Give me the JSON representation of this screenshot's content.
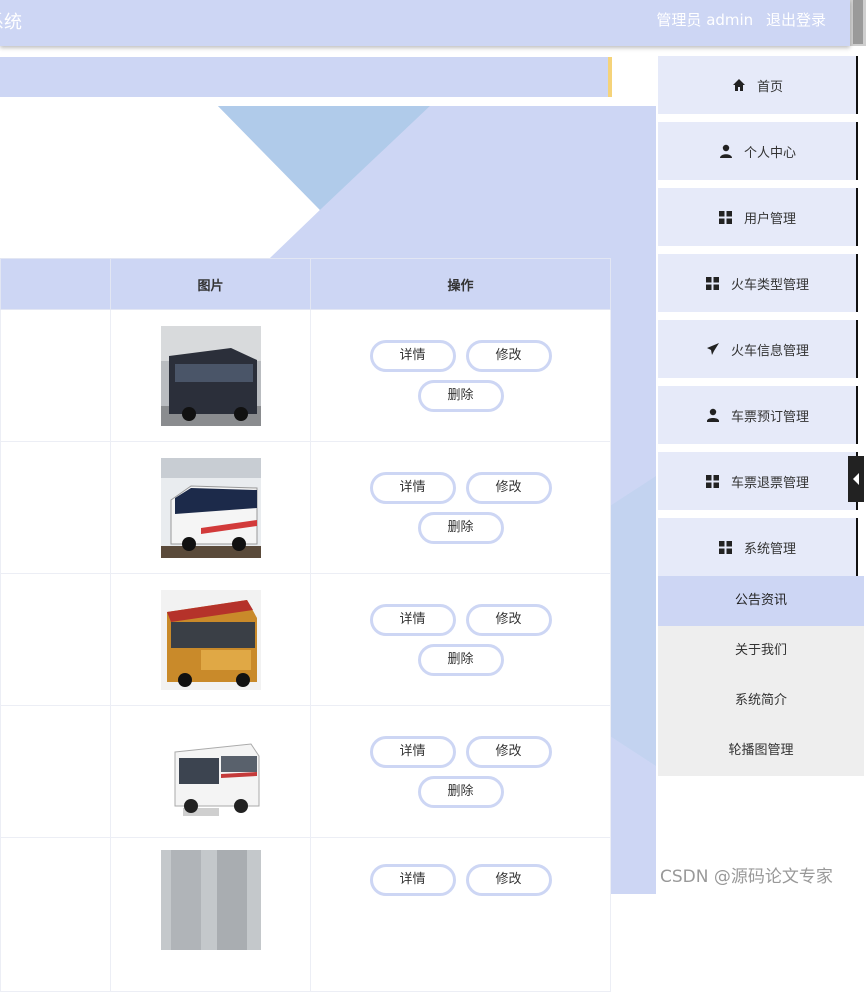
{
  "header": {
    "title_fragment": "系统",
    "user_label": "管理员 admin",
    "logout_label": "退出登录"
  },
  "table": {
    "columns": [
      "图片",
      "操作"
    ],
    "rows": [
      {
        "image": "coach-bus-dark-blue-photo",
        "actions": [
          "详情",
          "修改",
          "删除"
        ]
      },
      {
        "image": "coach-bus-white-blue-photo",
        "actions": [
          "详情",
          "修改",
          "删除"
        ]
      },
      {
        "image": "coach-bus-orange-photo",
        "actions": [
          "详情",
          "修改",
          "删除"
        ]
      },
      {
        "image": "coach-bus-white-photo",
        "actions": [
          "详情",
          "修改",
          "删除"
        ]
      },
      {
        "image": "building-photo",
        "actions": [
          "详情",
          "修改"
        ]
      }
    ]
  },
  "sidebar": {
    "items": [
      {
        "label": "首页",
        "icon": "home-icon"
      },
      {
        "label": "个人中心",
        "icon": "user-icon"
      },
      {
        "label": "用户管理",
        "icon": "grid-icon"
      },
      {
        "label": "火车类型管理",
        "icon": "grid-icon"
      },
      {
        "label": "火车信息管理",
        "icon": "paper-plane-icon"
      },
      {
        "label": "车票预订管理",
        "icon": "user-icon"
      },
      {
        "label": "车票退票管理",
        "icon": "grid-icon"
      },
      {
        "label": "系统管理",
        "icon": "grid-icon"
      }
    ],
    "submenu": {
      "active": "公告资讯",
      "items": [
        "关于我们",
        "系统简介",
        "轮播图管理"
      ]
    }
  },
  "watermark": "CSDN @源码论文专家",
  "colors": {
    "accent": "#cdd6f4",
    "crumb_border": "#f5d37a",
    "sidebar_bg": "#e6eaf9"
  }
}
